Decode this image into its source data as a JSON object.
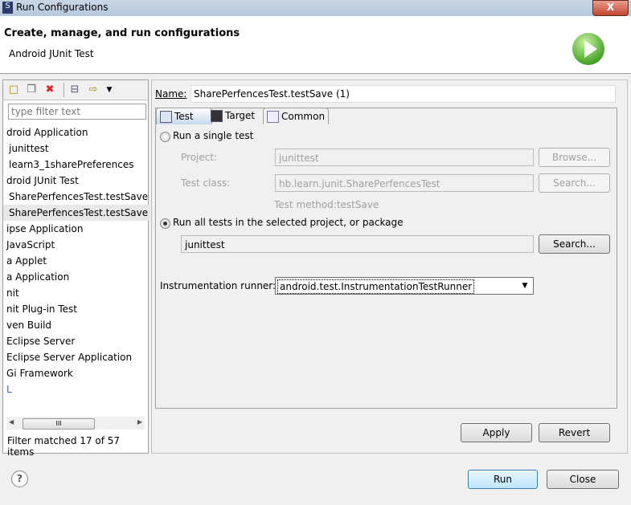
{
  "window": {
    "title": "Run Configurations",
    "close": "X"
  },
  "header": {
    "title": "Create, manage, and run configurations",
    "subtitle": "Android JUnit Test"
  },
  "left": {
    "toolbar": [
      "new-launch-configuration",
      "duplicate",
      "delete",
      "collapse-all",
      "filter",
      "view-menu"
    ],
    "filter_placeholder": "type filter text",
    "items": [
      "droid Application",
      "junittest",
      "learn3_1sharePreferences",
      "droid JUnit Test",
      "SharePerfencesTest.testSave",
      "SharePerfencesTest.testSave",
      "ipse Application",
      "JavaScript",
      "a Applet",
      "a Application",
      "nit",
      "nit Plug-in Test",
      "ven Build",
      "Eclipse Server",
      "Eclipse Server Application",
      "Gi Framework",
      "L"
    ],
    "selected_index": 5,
    "scroll_grip": "III",
    "status": "Filter matched 17 of 57 items"
  },
  "config": {
    "name_label": "Name:",
    "name_value": "SharePerfencesTest.testSave (1)",
    "tabs": [
      "Test",
      "Target",
      "Common"
    ],
    "single_test_label": "Run a single test",
    "project_label": "Project:",
    "project_value": "junittest",
    "browse": "Browse...",
    "test_class_label": "Test class:",
    "test_class_value": "hb.learn.junit.SharePerfencesTest",
    "search1": "Search...",
    "test_method": "Test method:testSave",
    "all_tests_label": "Run all tests in the selected project, or package",
    "package_value": "junittest",
    "search2": "Search...",
    "runner_label": "Instrumentation runner:",
    "runner_value": "android.test.InstrumentationTestRunner",
    "apply": "Apply",
    "revert": "Revert"
  },
  "footer": {
    "help": "?",
    "run": "Run",
    "close": "Close"
  }
}
